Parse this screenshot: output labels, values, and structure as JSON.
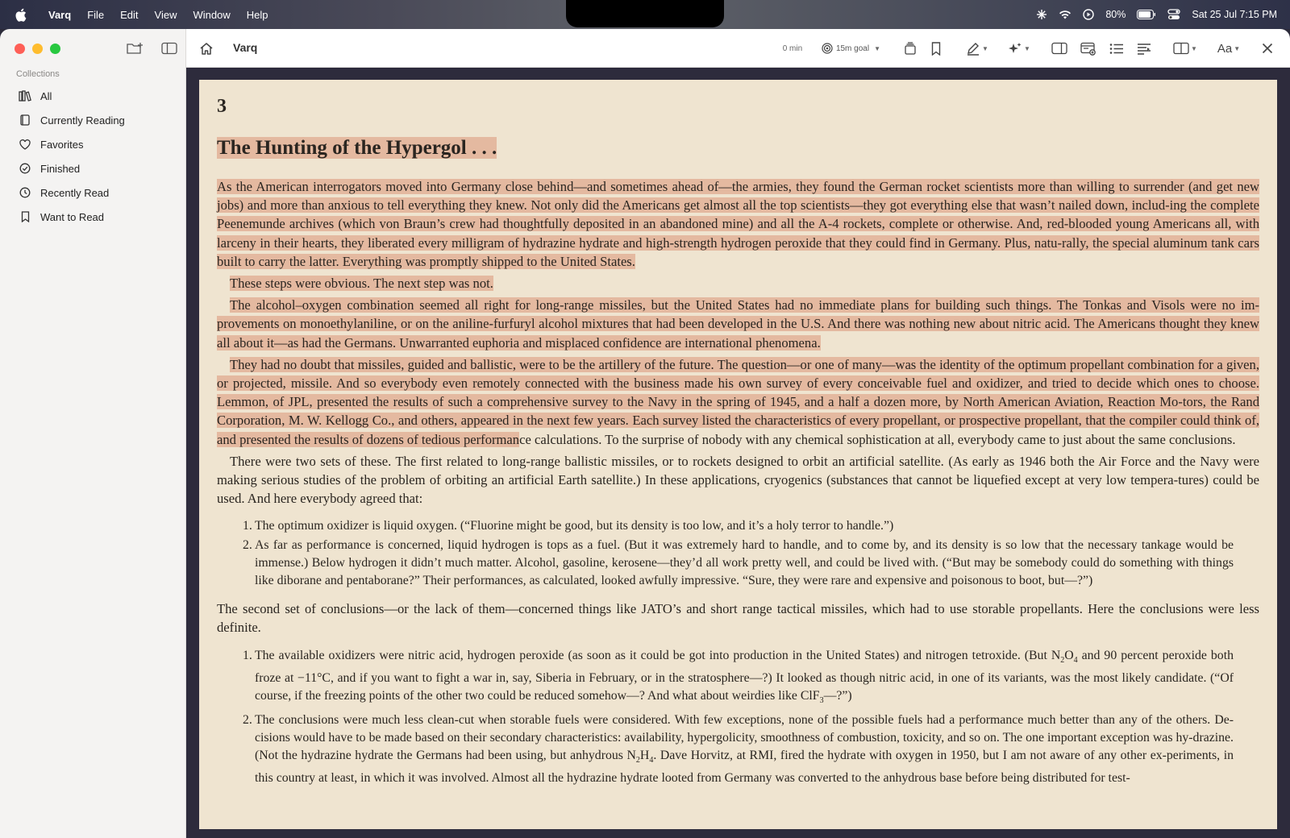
{
  "menubar": {
    "app_name": "Varq",
    "menus": [
      "File",
      "Edit",
      "View",
      "Window",
      "Help"
    ],
    "battery": "80%",
    "datetime": "Sat 25 Jul  7:15 PM"
  },
  "sidebar": {
    "heading": "Collections",
    "items": [
      {
        "label": "All",
        "icon": "books-icon"
      },
      {
        "label": "Currently Reading",
        "icon": "book-icon"
      },
      {
        "label": "Favorites",
        "icon": "heart-icon"
      },
      {
        "label": "Finished",
        "icon": "check-circle-icon"
      },
      {
        "label": "Recently Read",
        "icon": "clock-icon"
      },
      {
        "label": "Want to Read",
        "icon": "bookmark-icon"
      }
    ]
  },
  "toolbar": {
    "title": "Varq",
    "time_read": "0 min",
    "goal": "15m goal"
  },
  "book": {
    "chapter_number": "3",
    "chapter_title": "The Hunting of the Hypergol . . .",
    "p1": "As the American interrogators moved into Germany close behind—and sometimes ahead of—the armies, they found the German rocket scientists more than willing to surrender (and get new jobs) and more than anxious to tell everything they knew. Not only did the Americans get almost all the top scientists—they got everything else that wasn’t nailed down, includ-ing the complete Peenemunde archives (which von Braun’s crew had thoughtfully deposited in an abandoned mine) and all the A-4 rockets, complete or otherwise. And, red-blooded young Americans all, with larceny in their hearts, they liberated every milligram of hydrazine hydrate and high-strength hydrogen peroxide that they could find in Germany. Plus, natu-rally, the special aluminum tank cars built to carry the latter. Everything was promptly shipped to the United States.",
    "p2": "These steps were obvious. The next step was not.",
    "p3": "The alcohol–oxygen combination seemed all right for long-range missiles, but the United States had no immediate plans for building such things. The Tonkas and Visols were no im-provements on monoethylaniline, or on the aniline-furfuryl alcohol mixtures that had been developed in the U.S. And there was nothing new about nitric acid. The Americans thought they knew all about it—as had the Germans. Unwarranted euphoria and misplaced confidence are international phenomena.",
    "p4_highlighted": "They had no doubt that missiles, guided and ballistic, were to be the artillery of the future. The question—or one of many—was the identity of the optimum propellant combination for a given, or projected, missile. And so everybody even remotely connected with the business made his own survey of every conceivable fuel and oxidizer, and tried to decide which ones to choose. Lemmon, of JPL, presented the results of such a comprehensive survey to the Navy in the spring of 1945, and a half a dozen more, by North American Aviation, Reaction Mo-tors, the Rand Corporation, M. W. Kellogg Co., and others, appeared in the next few years. Each survey listed the characteristics of every propellant, or prospective propellant, that the compiler could think of, and presented the results of dozens of tedious performan",
    "p4_rest": "ce calculations. To the surprise of nobody with any chemical sophistication at all, everybody came to just about the same conclusions.",
    "p5": "There were two sets of these. The first related to long-range ballistic missiles, or to rockets designed to orbit an artificial satellite. (As early as 1946 both the Air Force and the Navy were making serious studies of the problem of orbiting an artificial Earth satellite.) In these applications, cryogenics (substances that cannot be liquefied except at very low tempera-tures) could be used. And here everybody agreed that:",
    "list1": [
      {
        "num": "1.",
        "text": "The optimum oxidizer is liquid oxygen. (“Fluorine might be good, but its density is too low, and it’s a holy terror to handle.”)"
      },
      {
        "num": "2.",
        "text": "As far as performance is concerned, liquid hydrogen is tops as a fuel. (But it was extremely hard to handle, and to come by, and its density is so low that the necessary tankage would be immense.) Below hydrogen it didn’t much matter. Alcohol, gasoline, kerosene—they’d all work pretty well, and could be lived with. (“But may be somebody could do something with things like diborane and pentaborane?” Their performances, as calculated, looked awfully impressive. “Sure, they were rare and expensive and poisonous to boot, but—?”)"
      }
    ],
    "p6": "The second set of conclusions—or the lack of them—concerned things like JATO’s and short range tactical missiles, which had to use storable propellants. Here the conclusions were less definite.",
    "list2_item1": {
      "num": "1.",
      "a": "The available oxidizers were nitric acid, hydrogen peroxide (as soon as it could be got into production in the United States) and nitrogen tetroxide. (But N",
      "sub1": "2",
      "b": "O",
      "sub2": "4",
      "c": " and 90 percent peroxide both froze at −11°C, and if you want to fight a war in, say, Siberia in February, or in the stratosphere—?) It looked as though nitric acid, in one of its variants, was the most likely candidate. (“Of course, if the freezing points of the other two could be reduced somehow—? And what about weirdies like ClF",
      "sub3": "3",
      "d": "—?”)"
    },
    "list2_item2": {
      "num": "2.",
      "a": "The conclusions were much less clean-cut when storable fuels were considered. With few exceptions, none of the possible fuels had a performance much better than any of the others. De-cisions would have to be made based on their secondary characteristics: availability, hypergolicity, smoothness of combustion, toxicity, and so on. The one important exception was hy-drazine. (Not the hydrazine hydrate the Germans had been using, but anhydrous N",
      "sub1": "2",
      "b": "H",
      "sub2": "4",
      "c": ". Dave Horvitz, at RMI, fired the hydrate with oxygen in 1950, but I am not aware of any other ex-periments, in this country at least, in which it was involved. Almost all the hydrazine hydrate looted from Germany was converted to the anhydrous base before being distributed for test-"
    }
  },
  "colors": {
    "page_bg": "#efe4d0",
    "highlight": "#e4b9a0",
    "content_bg": "#2d2b3c"
  }
}
